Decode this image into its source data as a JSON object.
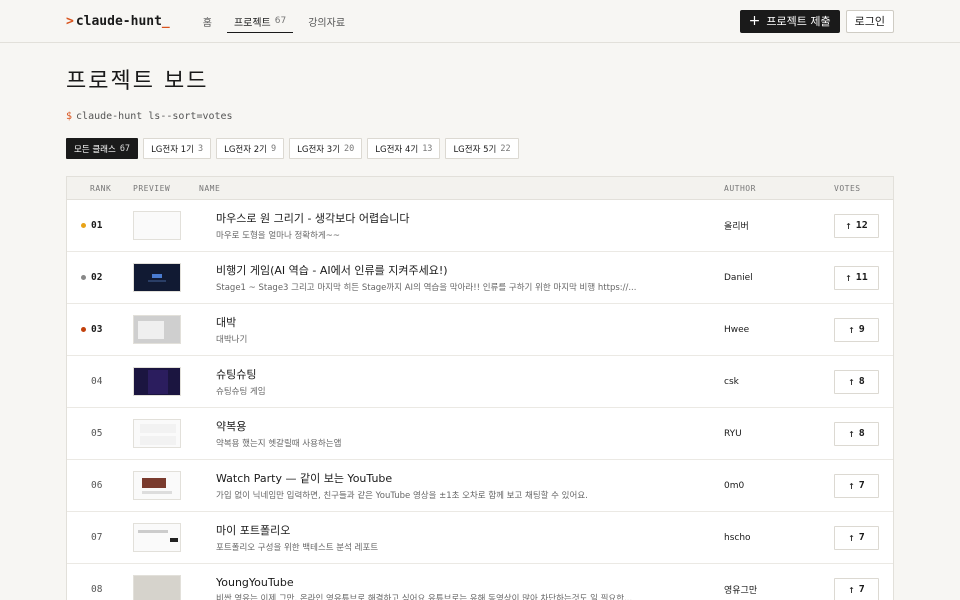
{
  "header": {
    "logo_prefix": ">",
    "logo_text": "claude-hunt",
    "logo_cursor": "_",
    "nav": [
      {
        "label": "홈",
        "count": ""
      },
      {
        "label": "프로젝트",
        "count": "67"
      },
      {
        "label": "강의자료",
        "count": ""
      }
    ],
    "submit_icon": "+",
    "submit_label": "프로젝트 제출",
    "login_label": "로그인"
  },
  "page": {
    "title": "프로젝트 보드",
    "cmd_prompt": "$",
    "cmd_text": "claude-hunt ls--sort=votes"
  },
  "filters": [
    {
      "label": "모든 클래스",
      "count": "67",
      "active": true
    },
    {
      "label": "LG전자 1기",
      "count": "3"
    },
    {
      "label": "LG전자 2기",
      "count": "9"
    },
    {
      "label": "LG전자 3기",
      "count": "20"
    },
    {
      "label": "LG전자 4기",
      "count": "13"
    },
    {
      "label": "LG전자 5기",
      "count": "22"
    }
  ],
  "table": {
    "headers": {
      "rank": "RANK",
      "preview": "PREVIEW",
      "name": "NAME",
      "author": "AUTHOR",
      "votes": "VOTES"
    },
    "rows": [
      {
        "rank": "01",
        "title": "마우스로 원 그리기 - 생각보다 어렵습니다",
        "desc": "마우로 도형을 얼마나 정확하게~~",
        "author": "올리버",
        "votes": "12",
        "dot": "#e8a317"
      },
      {
        "rank": "02",
        "title": "비행기 게임(AI 역습 - AI에서 인류를 지켜주세요!)",
        "desc": "Stage1 ~ Stage3 그리고 마지막 히든 Stage까지 AI의 역습을 막아라!! 인류를 구하기 위한 마지막 비행 https://...",
        "author": "Daniel",
        "votes": "11",
        "dot": "#888888"
      },
      {
        "rank": "03",
        "title": "대박",
        "desc": "대박나기",
        "author": "Hwee",
        "votes": "9",
        "dot": "#c2410c"
      },
      {
        "rank": "04",
        "title": "슈팅슈팅",
        "desc": "슈팅슈팅 게임",
        "author": "csk",
        "votes": "8"
      },
      {
        "rank": "05",
        "title": "약복용",
        "desc": "약복용 했는지 헷갈릴때 사용하는앱",
        "author": "RYU",
        "votes": "8"
      },
      {
        "rank": "06",
        "title": "Watch Party — 같이 보는 YouTube",
        "desc": "가입 없이 닉네임만 입력하면, 친구들과 같은 YouTube 영상을 ±1초 오차로 함께 보고 채팅할 수 있어요.",
        "author": "0m0",
        "votes": "7"
      },
      {
        "rank": "07",
        "title": "마이 포트폴리오",
        "desc": "포트폴리오 구성을 위한 백테스트 분석 레포트",
        "author": "hscho",
        "votes": "7"
      },
      {
        "rank": "08",
        "title": "YoungYouTube",
        "desc": "비싼 영유는 이제 그만. 온라인 영유튜브로 해결하고 싶어요 유튜브로는 유해 동영상이 많아 차단하는것도 일 필요한...",
        "author": "영유그만",
        "votes": "7"
      }
    ]
  },
  "vote_icon": "arrow-up-icon"
}
